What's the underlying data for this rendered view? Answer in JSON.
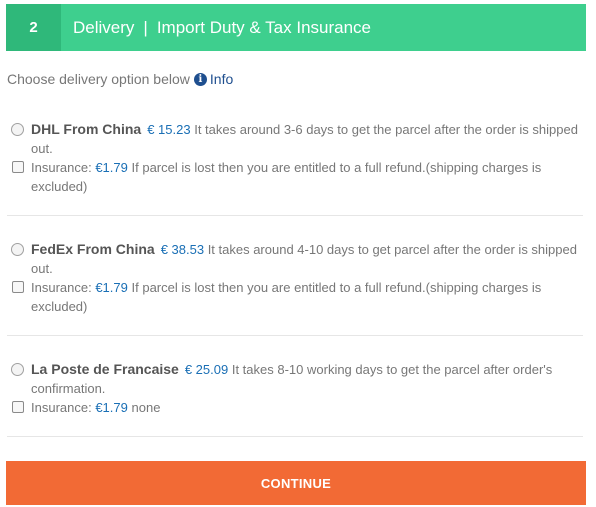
{
  "header": {
    "step": "2",
    "title": "Delivery",
    "separator": "|",
    "subtitle": "Import Duty & Tax Insurance"
  },
  "prompt": {
    "text": "Choose delivery option below",
    "info_label": "Info"
  },
  "options": [
    {
      "name": "DHL From China",
      "price": "€ 15.23",
      "description": "It takes around 3-6 days to get the parcel after the order is shipped out.",
      "insurance_label": "Insurance:",
      "insurance_amount": "€1.79",
      "insurance_note": "If parcel is lost then you are entitled to a full refund.(shipping charges is excluded)"
    },
    {
      "name": "FedEx From China",
      "price": "€ 38.53",
      "description": "It takes around 4-10 days to get parcel after the order is shipped out.",
      "insurance_label": "Insurance:",
      "insurance_amount": "€1.79",
      "insurance_note": "If parcel is lost then you are entitled to a full refund.(shipping charges is excluded)"
    },
    {
      "name": "La Poste de Francaise",
      "price": "€ 25.09",
      "description": "It takes 8-10 working days to get the parcel after order's confirmation.",
      "insurance_label": "Insurance:",
      "insurance_amount": "€1.79",
      "insurance_note": "none"
    }
  ],
  "continue_label": "CONTINUE",
  "colors": {
    "header_bg": "#3ecf8e",
    "step_bg": "#2fb87a",
    "price": "#1a6fb5",
    "continue_bg": "#f26a35"
  }
}
